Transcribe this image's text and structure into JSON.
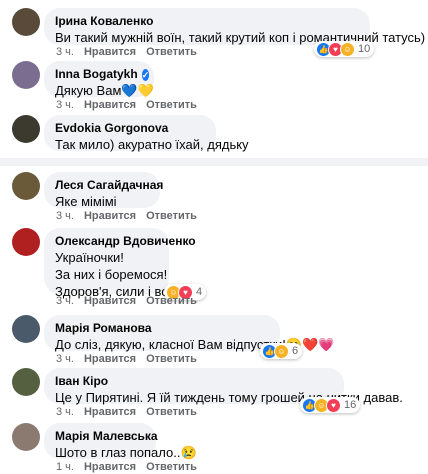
{
  "comments": [
    {
      "author": "Ірина Коваленко",
      "verified": false,
      "lines": [
        "Ви такий мужній воїн, такий крутий коп і романтичний татусь)"
      ],
      "time": "3 ч.",
      "like": "Нравится",
      "reply": "Ответить",
      "reactions": [
        "like-icon",
        "love-icon",
        "care-icon"
      ],
      "count": "10",
      "avatar_color": "#5a4a3a"
    },
    {
      "author": "Inna Bogatykh",
      "verified": true,
      "lines": [
        "Дякую Вам💙💛"
      ],
      "time": "3 ч.",
      "like": "Нравится",
      "reply": "Ответить",
      "reactions": [],
      "count": "",
      "avatar_color": "#7a6d90"
    },
    {
      "author": "Evdokia Gorgonova",
      "verified": false,
      "lines": [
        "Так мило) акуратно їхай, дядьку"
      ],
      "time": "3 ч.",
      "like": "Нравится",
      "reply": "Ответить",
      "reactions": [],
      "count": "",
      "avatar_color": "#3c3a2e"
    },
    {
      "author": "Леся Сагайдачная",
      "verified": false,
      "lines": [
        "Яке мімімі"
      ],
      "time": "3 ч.",
      "like": "Нравится",
      "reply": "Ответить",
      "reactions": [],
      "count": "",
      "avatar_color": "#6b5a3a"
    },
    {
      "author": "Олександр Вдовиченко",
      "verified": false,
      "lines": [
        "Україночки!",
        "За них і боремося!",
        "Здоров'я, сили і волі!"
      ],
      "time": "3 ч.",
      "like": "Нравится",
      "reply": "Ответить",
      "reactions": [
        "care-icon",
        "love-icon"
      ],
      "count": "4",
      "avatar_color": "#b02020"
    },
    {
      "author": "Марія Романова",
      "verified": false,
      "lines": [
        "До сліз, дякую, класної Вам відпустки!😊❤️💗"
      ],
      "time": "3 ч.",
      "like": "Нравится",
      "reply": "Ответить",
      "reactions": [
        "like-icon",
        "care-icon"
      ],
      "count": "6",
      "avatar_color": "#4a5a6a"
    },
    {
      "author": "Іван Кіро",
      "verified": false,
      "lines": [
        "Це у Пирятині. Я їй тиждень тому грошей на нитки давав."
      ],
      "time": "3 ч.",
      "like": "Нравится",
      "reply": "Ответить",
      "reactions": [
        "like-icon",
        "haha-icon",
        "love-icon"
      ],
      "count": "16",
      "avatar_color": "#556040"
    },
    {
      "author": "Марія Малевська",
      "verified": false,
      "lines": [
        "Шото в глаз попало..😢"
      ],
      "time": "1 ч.",
      "like": "Нравится",
      "reply": "Ответить",
      "reactions": [],
      "count": "",
      "avatar_color": "#8a7a70"
    }
  ],
  "colors": {
    "bubble": "#f0f2f5",
    "meta": "#65676b",
    "like": "#1877f2",
    "love": "#f33e58",
    "care": "#f7b125"
  }
}
